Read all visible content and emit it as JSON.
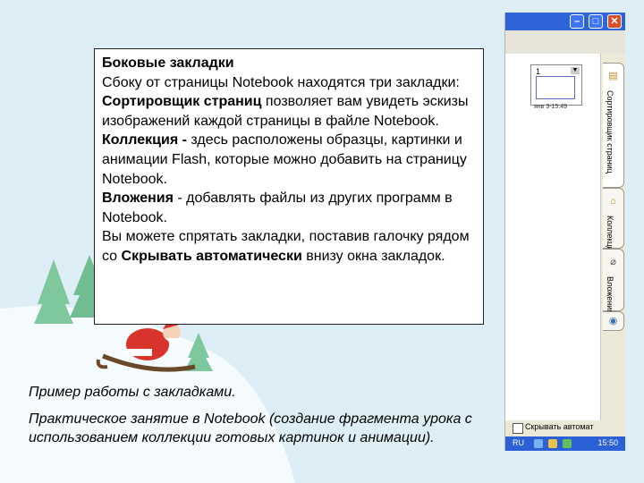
{
  "info_box": {
    "heading": "Боковые закладки",
    "intro": "Сбоку от страницы Notebook находятся три закладки:",
    "sorter_term": "Сортировщик страниц",
    "sorter_text": " позволяет вам увидеть эскизы изображений каждой страницы в файле Notebook.",
    "gallery_term": " Коллекция - ",
    "gallery_text": "здесь расположены образцы, картинки и анимации Flash, которые можно добавить на страницу Notebook.",
    "attach_term": "Вложения",
    "attach_text": " -  добавлять файлы из других программ в Notebook.",
    "hide_text_start": "Вы можете спрятать закладки, поставив галочку рядом со ",
    "hide_term": "Скрывать автоматически",
    "hide_text_end": " внизу окна закладок."
  },
  "captions": {
    "example": "Пример работы с закладками.",
    "practice": "Практическое  занятие в Notebook (создание фрагмента урока с  использованием коллекции готовых картинок и анимации)."
  },
  "sidebar": {
    "thumb_number": "1",
    "thumb_caption": "янв 3-15:49",
    "tabs": [
      {
        "label": "Сортировщик страниц"
      },
      {
        "label": "Коллекция"
      },
      {
        "label": "Вложения"
      }
    ],
    "auto_hide_label": "Скрывать автомат",
    "taskbar": {
      "lang": "RU",
      "clock": "15:50"
    }
  },
  "colors": {
    "background": "#ddeef6",
    "titlebar": "#2f63d8",
    "taskbar": "#2b60d6"
  }
}
